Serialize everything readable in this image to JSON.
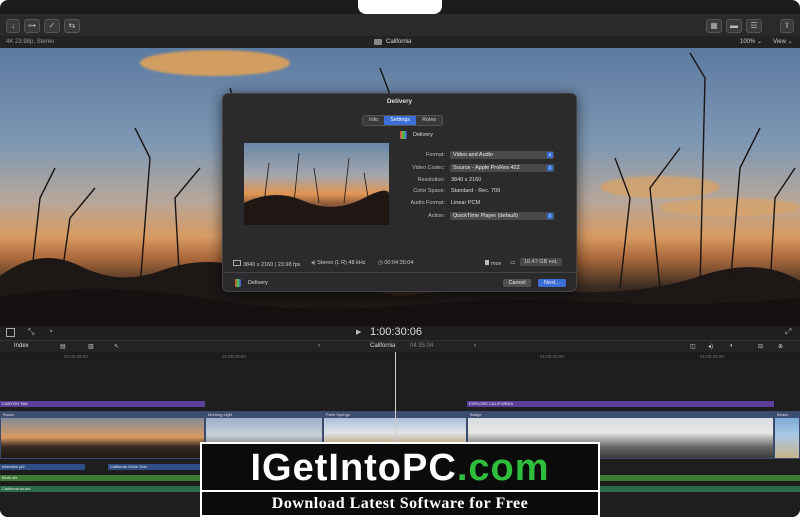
{
  "toolbar": {
    "left_buttons": [
      "↓",
      "⊶",
      "✓",
      "⇆"
    ],
    "right_buttons": [
      "▦",
      "▬",
      "☰",
      "⇪"
    ]
  },
  "infobar": {
    "format": "4K 23.98p, Stereo",
    "project": "California",
    "zoom": "100%",
    "zoom_chevron": "⌄",
    "view": "View",
    "view_chevron": "⌄"
  },
  "dialog": {
    "title": "Delivery",
    "tabs": [
      "Info",
      "Settings",
      "Roles"
    ],
    "selected_tab": "Settings",
    "preset_name": "Delivery",
    "fields": [
      {
        "label": "Format:",
        "value": "Video and Audio",
        "type": "popup"
      },
      {
        "label": "Video Codec:",
        "value": "Source - Apple ProRes 422",
        "type": "popup"
      },
      {
        "label": "Resolution:",
        "value": "3840 x 2160",
        "type": "text"
      },
      {
        "label": "Color Space:",
        "value": "Standard - Rec. 709",
        "type": "text"
      },
      {
        "label": "Audio Format:",
        "value": "Linear PCM",
        "type": "text"
      },
      {
        "label": "Action:",
        "value": "QuickTime Player (default)",
        "type": "popup"
      }
    ],
    "stats": {
      "resolution": "3840 x 2160 | 23.98 fps",
      "audio": "Stereo (L R) 48 kHz",
      "duration": "00:04:35:04",
      "container": "mov",
      "size": "16.47 GB est."
    },
    "footer_name": "Delivery",
    "cancel_label": "Cancel",
    "next_label": "Next..."
  },
  "viewer_controls": {
    "play": "▶",
    "timecode": "1:00:30:06"
  },
  "timeline": {
    "index_label": "Index",
    "project": "California",
    "duration": "04:35:04",
    "ruler": [
      "01:00:28:00",
      "01:00:30:00",
      "01:00:32:00",
      "01:00:34:00"
    ],
    "titles": [
      {
        "label": "CANYON Title"
      },
      {
        "label": "EXPLORE CALIFORNIA"
      }
    ],
    "clips": [
      {
        "label": "Rocks"
      },
      {
        "label": "Morning Light"
      },
      {
        "label": "Palm Springs"
      },
      {
        "label": "Bridge"
      },
      {
        "label": "Beach"
      }
    ],
    "audio_rows": [
      {
        "label": "Interview pt2",
        "label2": "California Voice Over"
      },
      {
        "label": "Birds sfx",
        "label2": ""
      },
      {
        "label": "California music",
        "label2": ""
      }
    ]
  },
  "watermark": {
    "line1_a": "IGetIntoPC",
    "line1_b": ".com",
    "line2": "Download Latest Software for Free"
  },
  "colors": {
    "accent": "#3b6ed6",
    "title_track": "#5b3f9b",
    "clip_label": "#3e4e72",
    "audio_blue": "#2f4e86",
    "audio_green": "#3c7a35",
    "audio_green_dark": "#2b6a4a",
    "watermark_green": "#2fbe3c"
  }
}
